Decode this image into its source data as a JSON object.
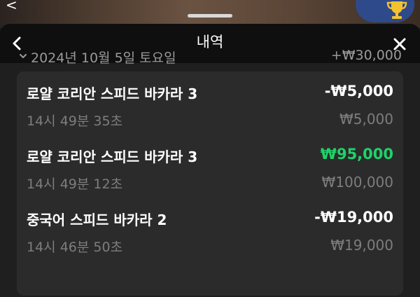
{
  "backdrop": {
    "back_glyph": "<"
  },
  "header": {
    "title": "내역",
    "back_icon": "chevron-left-icon",
    "close_icon": "close-icon"
  },
  "colors": {
    "win": "#1fd26a",
    "trophy_bg": "#2f4a8a",
    "trophy": "#f2c230"
  },
  "day": {
    "date": "2024년 10월 5일 토요일",
    "total": "+₩30,000",
    "icon": "chevron-down-icon"
  },
  "items": [
    {
      "name": "로얄 코리안 스피드 바카라 3",
      "amount": "-₩5,000",
      "time": "14시 49분 35초",
      "stake": "₩5,000",
      "win": false
    },
    {
      "name": "로얄 코리안 스피드 바카라 3",
      "amount": "₩95,000",
      "time": "14시 49분 12초",
      "stake": "₩100,000",
      "win": true
    },
    {
      "name": "중국어 스피드 바카라 2",
      "amount": "-₩19,000",
      "time": "14시 46분 50초",
      "stake": "₩19,000",
      "win": false
    }
  ]
}
